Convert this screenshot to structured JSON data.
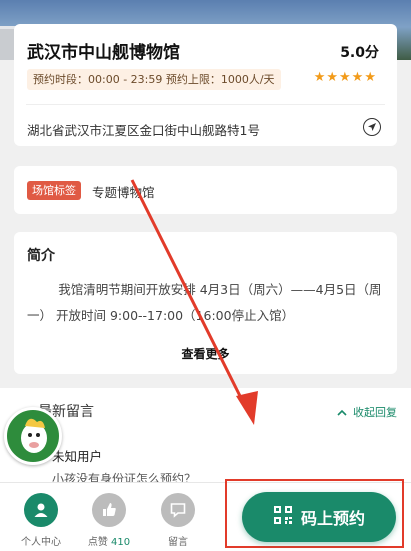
{
  "venue": {
    "title": "武汉市中山舰博物馆",
    "score": "5.0分",
    "booking_info": "预约时段：00:00 - 23:59 预约上限：1000人/天",
    "stars": "★★★★★",
    "address": "湖北省武汉市江夏区金口街中山舰路特1号"
  },
  "tags": {
    "venue_tag": "场馆标签",
    "venue_type": "专题博物馆"
  },
  "intro": {
    "title": "简介",
    "body": "我馆清明节期间开放安排 4月3日（周六）——4月5日（周一） 开放时间 9:00--17:00（16:00停止入馆）",
    "see_more": "查看更多"
  },
  "comments": {
    "title": "最新留言",
    "collapse": "收起回复",
    "user": "未知用户",
    "text": "小孩没有身份证怎么预约？"
  },
  "bottom_bar": {
    "personal": "个人中心",
    "like": "点赞",
    "like_count": "410",
    "message": "留言",
    "reserve": "码上预约"
  },
  "colors": {
    "accent": "#1a8a6a",
    "tag_red": "#e05a44",
    "star": "#f29b1a",
    "annotation": "#e23b2a"
  }
}
